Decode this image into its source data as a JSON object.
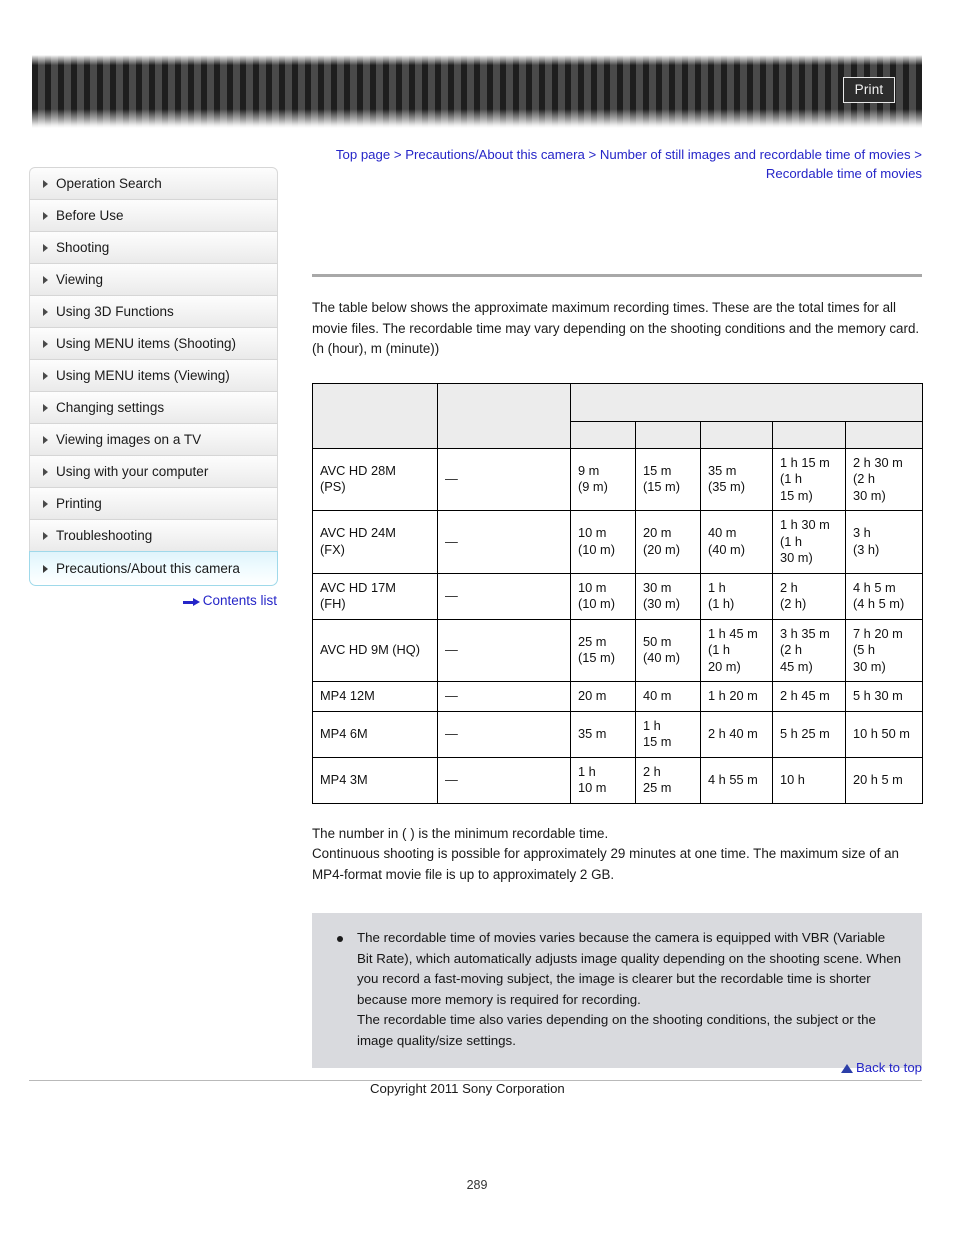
{
  "banner": {
    "print_label": "Print"
  },
  "sidebar": {
    "items": [
      {
        "label": "Operation Search",
        "active": false
      },
      {
        "label": "Before Use",
        "active": false
      },
      {
        "label": "Shooting",
        "active": false
      },
      {
        "label": "Viewing",
        "active": false
      },
      {
        "label": "Using 3D Functions",
        "active": false
      },
      {
        "label": "Using MENU items (Shooting)",
        "active": false
      },
      {
        "label": "Using MENU items (Viewing)",
        "active": false
      },
      {
        "label": "Changing settings",
        "active": false
      },
      {
        "label": "Viewing images on a TV",
        "active": false
      },
      {
        "label": "Using with your computer",
        "active": false
      },
      {
        "label": "Printing",
        "active": false
      },
      {
        "label": "Troubleshooting",
        "active": false
      },
      {
        "label": "Precautions/About this camera",
        "active": true
      }
    ],
    "contents_list_label": "Contents list"
  },
  "breadcrumb": {
    "items": [
      "Top page",
      "Precautions/About this camera",
      "Number of still images and recordable time of movies",
      "Recordable time of movies"
    ],
    "separator": " > "
  },
  "intro": {
    "paragraph": "The table below shows the approximate maximum recording times. These are the total times for all movie files. The recordable time may vary depending on the shooting conditions and the memory card.",
    "units_note": "(h (hour), m (minute))"
  },
  "chart_data": {
    "type": "table",
    "title": "Recordable time of movies",
    "columns": [
      "",
      "",
      "",
      "",
      "",
      "",
      ""
    ],
    "header_group_label": "",
    "rows": [
      {
        "model": "AVC HD 28M (PS)",
        "model_lines": [
          "AVC HD 28M",
          "(PS)"
        ],
        "cells": [
          {
            "lines": [
              "—"
            ]
          },
          {
            "lines": [
              "9 m",
              "(9 m)"
            ]
          },
          {
            "lines": [
              "15 m",
              "(15 m)"
            ]
          },
          {
            "lines": [
              "35 m",
              "(35 m)"
            ]
          },
          {
            "lines": [
              "1 h 15 m",
              "(1 h",
              "15 m)"
            ]
          },
          {
            "lines": [
              "2 h 30 m",
              "(2 h",
              "30 m)"
            ]
          }
        ]
      },
      {
        "model": "AVC HD 24M (FX)",
        "model_lines": [
          "AVC HD 24M",
          "(FX)"
        ],
        "cells": [
          {
            "lines": [
              "—"
            ]
          },
          {
            "lines": [
              "10 m",
              "(10 m)"
            ]
          },
          {
            "lines": [
              "20 m",
              "(20 m)"
            ]
          },
          {
            "lines": [
              "40 m",
              "(40 m)"
            ]
          },
          {
            "lines": [
              "1 h 30 m",
              "(1 h",
              "30 m)"
            ]
          },
          {
            "lines": [
              "3 h",
              "(3 h)"
            ]
          }
        ]
      },
      {
        "model": "AVC HD 17M (FH)",
        "model_lines": [
          "AVC HD 17M",
          "(FH)"
        ],
        "cells": [
          {
            "lines": [
              "—"
            ]
          },
          {
            "lines": [
              "10 m",
              "(10 m)"
            ]
          },
          {
            "lines": [
              "30 m",
              "(30 m)"
            ]
          },
          {
            "lines": [
              "1 h",
              "(1 h)"
            ]
          },
          {
            "lines": [
              "2 h",
              "(2 h)"
            ]
          },
          {
            "lines": [
              "4 h 5 m",
              "(4 h 5 m)"
            ]
          }
        ]
      },
      {
        "model": "AVC HD 9M (HQ)",
        "model_lines": [
          "AVC HD 9M (HQ)"
        ],
        "cells": [
          {
            "lines": [
              "—"
            ]
          },
          {
            "lines": [
              "25 m",
              "(15 m)"
            ]
          },
          {
            "lines": [
              "50 m",
              "(40 m)"
            ]
          },
          {
            "lines": [
              "1 h 45 m",
              "(1 h",
              "20 m)"
            ]
          },
          {
            "lines": [
              "3 h 35 m",
              "(2 h",
              "45 m)"
            ]
          },
          {
            "lines": [
              "7 h 20 m",
              "(5 h",
              "30 m)"
            ]
          }
        ]
      },
      {
        "model": "MP4 12M",
        "model_lines": [
          "MP4 12M"
        ],
        "cells": [
          {
            "lines": [
              "—"
            ]
          },
          {
            "lines": [
              "20 m"
            ]
          },
          {
            "lines": [
              "40 m"
            ]
          },
          {
            "lines": [
              "1 h 20 m"
            ]
          },
          {
            "lines": [
              "2 h 45 m"
            ]
          },
          {
            "lines": [
              "5 h 30 m"
            ]
          }
        ]
      },
      {
        "model": "MP4 6M",
        "model_lines": [
          "MP4 6M"
        ],
        "cells": [
          {
            "lines": [
              "—"
            ]
          },
          {
            "lines": [
              "35 m"
            ]
          },
          {
            "lines": [
              "1 h",
              "15 m"
            ]
          },
          {
            "lines": [
              "2 h 40 m"
            ]
          },
          {
            "lines": [
              "5 h 25 m"
            ]
          },
          {
            "lines": [
              "10 h 50 m"
            ]
          }
        ]
      },
      {
        "model": "MP4 3M",
        "model_lines": [
          "MP4 3M"
        ],
        "cells": [
          {
            "lines": [
              "—"
            ]
          },
          {
            "lines": [
              "1 h",
              "10 m"
            ]
          },
          {
            "lines": [
              "2 h",
              "25 m"
            ]
          },
          {
            "lines": [
              "4 h 55 m"
            ]
          },
          {
            "lines": [
              "10 h"
            ]
          },
          {
            "lines": [
              "20 h 5 m"
            ]
          }
        ]
      }
    ]
  },
  "post_table_note": {
    "line1": "The number in ( ) is the minimum recordable time.",
    "line2": "Continuous shooting is possible for approximately 29 minutes at one time. The maximum size of an MP4-format movie file is up to approximately 2 GB."
  },
  "vbr_note": {
    "para1": "The recordable time of movies varies because the camera is equipped with VBR (Variable Bit Rate), which automatically adjusts image quality depending on the shooting scene. When you record a fast-moving subject, the image is clearer but the recordable time is shorter because more memory is required for recording.",
    "para2": "The recordable time also varies depending on the shooting conditions, the subject or the image quality/size settings."
  },
  "footer": {
    "back_to_top_label": "Back to top",
    "copyright": "Copyright 2011 Sony Corporation",
    "page_number": "289"
  },
  "colors": {
    "link": "#2525c8",
    "active_nav_border": "#9fd9ea",
    "note_box_bg": "#d9dade",
    "rule": "#a8a8a8"
  }
}
